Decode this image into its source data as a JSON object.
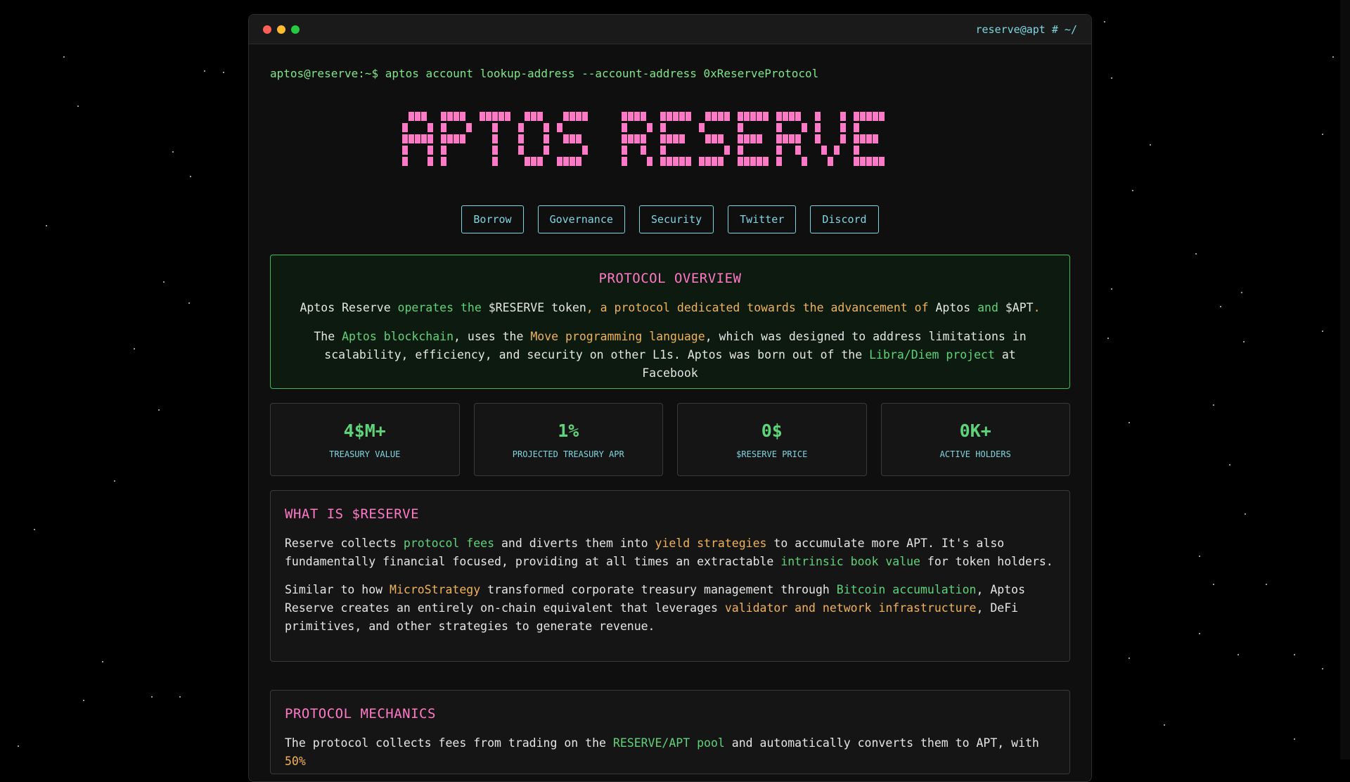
{
  "window": {
    "prompt_label": "reserve@apt # ~/"
  },
  "command": "aptos@reserve:~$ aptos account lookup-address --account-address 0xReserveProtocol",
  "logo": {
    "text": "APTOS RESERVE",
    "color": "#ff79c6"
  },
  "nav": [
    "Borrow",
    "Governance",
    "Security",
    "Twitter",
    "Discord"
  ],
  "overview": {
    "title": "PROTOCOL OVERVIEW",
    "p1": [
      "Aptos Reserve",
      " operates the ",
      "$RESERVE token",
      ", a protocol dedicated towards the advancement of ",
      "Aptos",
      " and ",
      "$APT",
      "."
    ],
    "p2": [
      "The ",
      "Aptos blockchain",
      ", uses the ",
      "Move programming language",
      ", which was designed to address limitations in scalability, efficiency, and security on other L1s. Aptos was born out of the ",
      "Libra/Diem project",
      " at Facebook"
    ]
  },
  "stats": [
    {
      "value": "4$M+",
      "label": "TREASURY VALUE"
    },
    {
      "value": "1%",
      "label": "PROJECTED TREASURY APR"
    },
    {
      "value": "0$",
      "label": "$RESERVE PRICE"
    },
    {
      "value": "0K+",
      "label": "ACTIVE HOLDERS"
    }
  ],
  "what_is": {
    "title": "WHAT IS $RESERVE",
    "p1": [
      "Reserve collects ",
      "protocol fees",
      " and diverts them into ",
      "yield strategies",
      " to accumulate more APT. It's also fundamentally financial focused, providing at all times an extractable ",
      "intrinsic book value",
      " for token holders."
    ],
    "p2": [
      "Similar to how ",
      "MicroStrategy",
      " transformed corporate treasury management through ",
      "Bitcoin accumulation",
      ", Aptos Reserve creates an entirely on-chain equivalent that leverages ",
      "validator and network infrastructure",
      ", DeFi primitives, and other strategies to generate revenue."
    ]
  },
  "mechanics": {
    "title": "PROTOCOL MECHANICS",
    "p1": [
      "The protocol collects fees from trading on the ",
      "RESERVE/APT pool",
      " and automatically converts them to APT, with ",
      "50%"
    ]
  },
  "colors": {
    "green": "#5fd37a",
    "orange": "#f0b35a",
    "pink": "#ff79c6",
    "cyan": "#7fd6e0"
  }
}
